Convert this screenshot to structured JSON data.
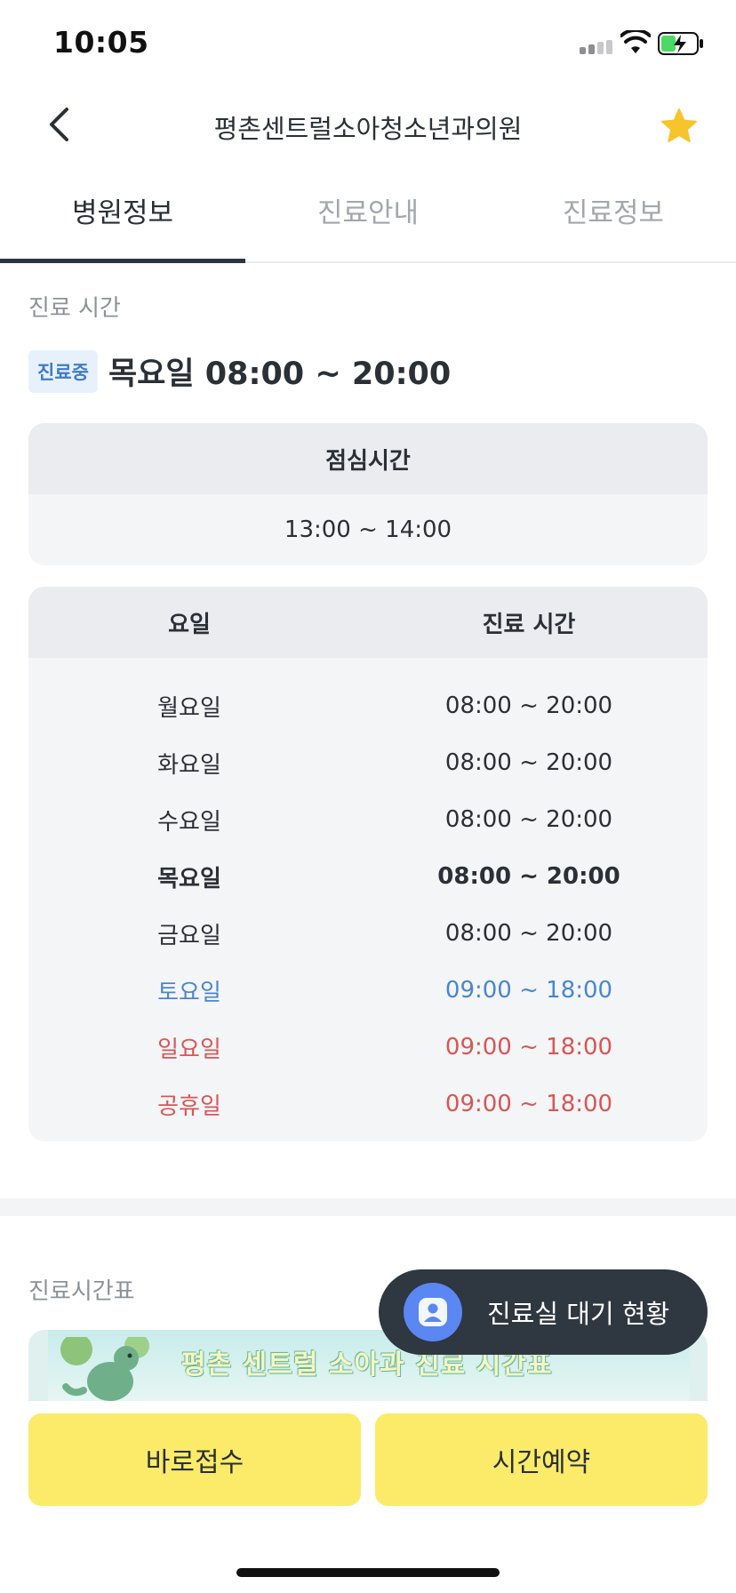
{
  "status_bar": {
    "time": "10:05"
  },
  "header": {
    "title": "평촌센트럴소아청소년과의원"
  },
  "tabs": [
    {
      "label": "병원정보",
      "active": true
    },
    {
      "label": "진료안내",
      "active": false
    },
    {
      "label": "진료정보",
      "active": false
    }
  ],
  "hours": {
    "section_label": "진료 시간",
    "badge": "진료중",
    "today": "목요일 08:00 ~ 20:00"
  },
  "lunch": {
    "header": "점심시간",
    "time": "13:00 ~ 14:00"
  },
  "schedule": {
    "headers": {
      "day": "요일",
      "time": "진료 시간"
    },
    "rows": [
      {
        "day": "월요일",
        "time": "08:00 ~ 20:00"
      },
      {
        "day": "화요일",
        "time": "08:00 ~ 20:00"
      },
      {
        "day": "수요일",
        "time": "08:00 ~ 20:00"
      },
      {
        "day": "목요일",
        "time": "08:00 ~ 20:00"
      },
      {
        "day": "금요일",
        "time": "08:00 ~ 20:00"
      },
      {
        "day": "토요일",
        "time": "09:00 ~ 18:00"
      },
      {
        "day": "일요일",
        "time": "09:00 ~ 18:00"
      },
      {
        "day": "공휴일",
        "time": "09:00 ~ 18:00"
      }
    ]
  },
  "timetable": {
    "section_label": "진료시간표",
    "banner_text": "평촌 센트럴 소아과 진료 시간표"
  },
  "fab": {
    "label": "진료실 대기 현황",
    "icon": "person-icon"
  },
  "actions": {
    "walk_in": "바로접수",
    "reserve": "시간예약"
  },
  "colors": {
    "accent_yellow": "#fbeb68",
    "saturday_blue": "#4a86cf",
    "holiday_red": "#d85656",
    "badge_blue": "#3f7cc6",
    "fab_dark": "#2f3740"
  }
}
